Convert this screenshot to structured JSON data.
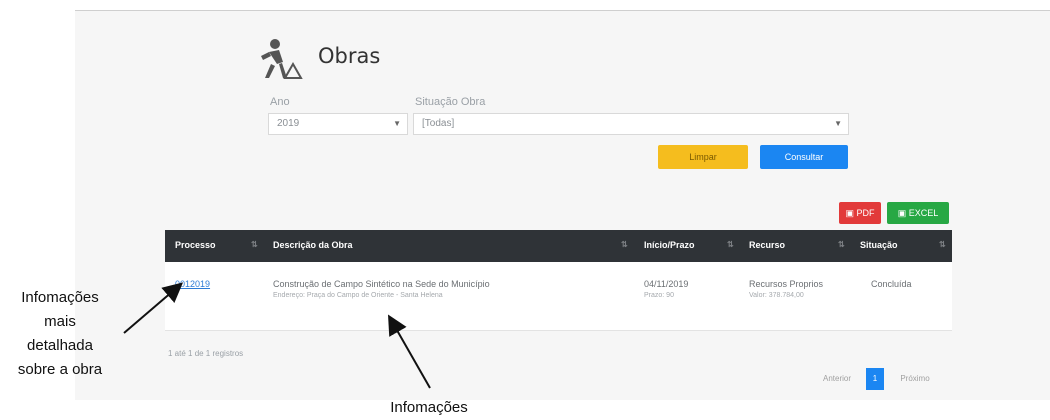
{
  "page": {
    "title": "Obras",
    "filters": {
      "year_label": "Ano",
      "year_value": "2019",
      "status_label": "Situação Obra",
      "status_value": "[Todas]"
    },
    "buttons": {
      "clear": "Limpar",
      "query": "Consultar",
      "pdf": "PDF",
      "excel": "EXCEL"
    },
    "table": {
      "headers": [
        "Processo",
        "Descrição da Obra",
        "Início/Prazo",
        "Recurso",
        "Situação"
      ],
      "rows": [
        {
          "process": "0012019",
          "description": "Construção de Campo Sintético na Sede do Município",
          "address": "Endereço: Praça do Campo de Oriente - Santa Helena",
          "start_date": "04/11/2019",
          "deadline": "Prazo: 90",
          "resource": "Recursos Proprios",
          "resource_value": "Valor: 378.784,00",
          "status": "Concluída"
        }
      ]
    },
    "footer_info": "1 até 1 de 1 registros",
    "pagination": {
      "prev": "Anterior",
      "current": "1",
      "next": "Próximo"
    }
  },
  "annotations": {
    "left_note_lines": [
      "Infomações",
      "mais",
      "detalhada",
      "sobre a obra"
    ],
    "bottom_note": "Infomações"
  }
}
